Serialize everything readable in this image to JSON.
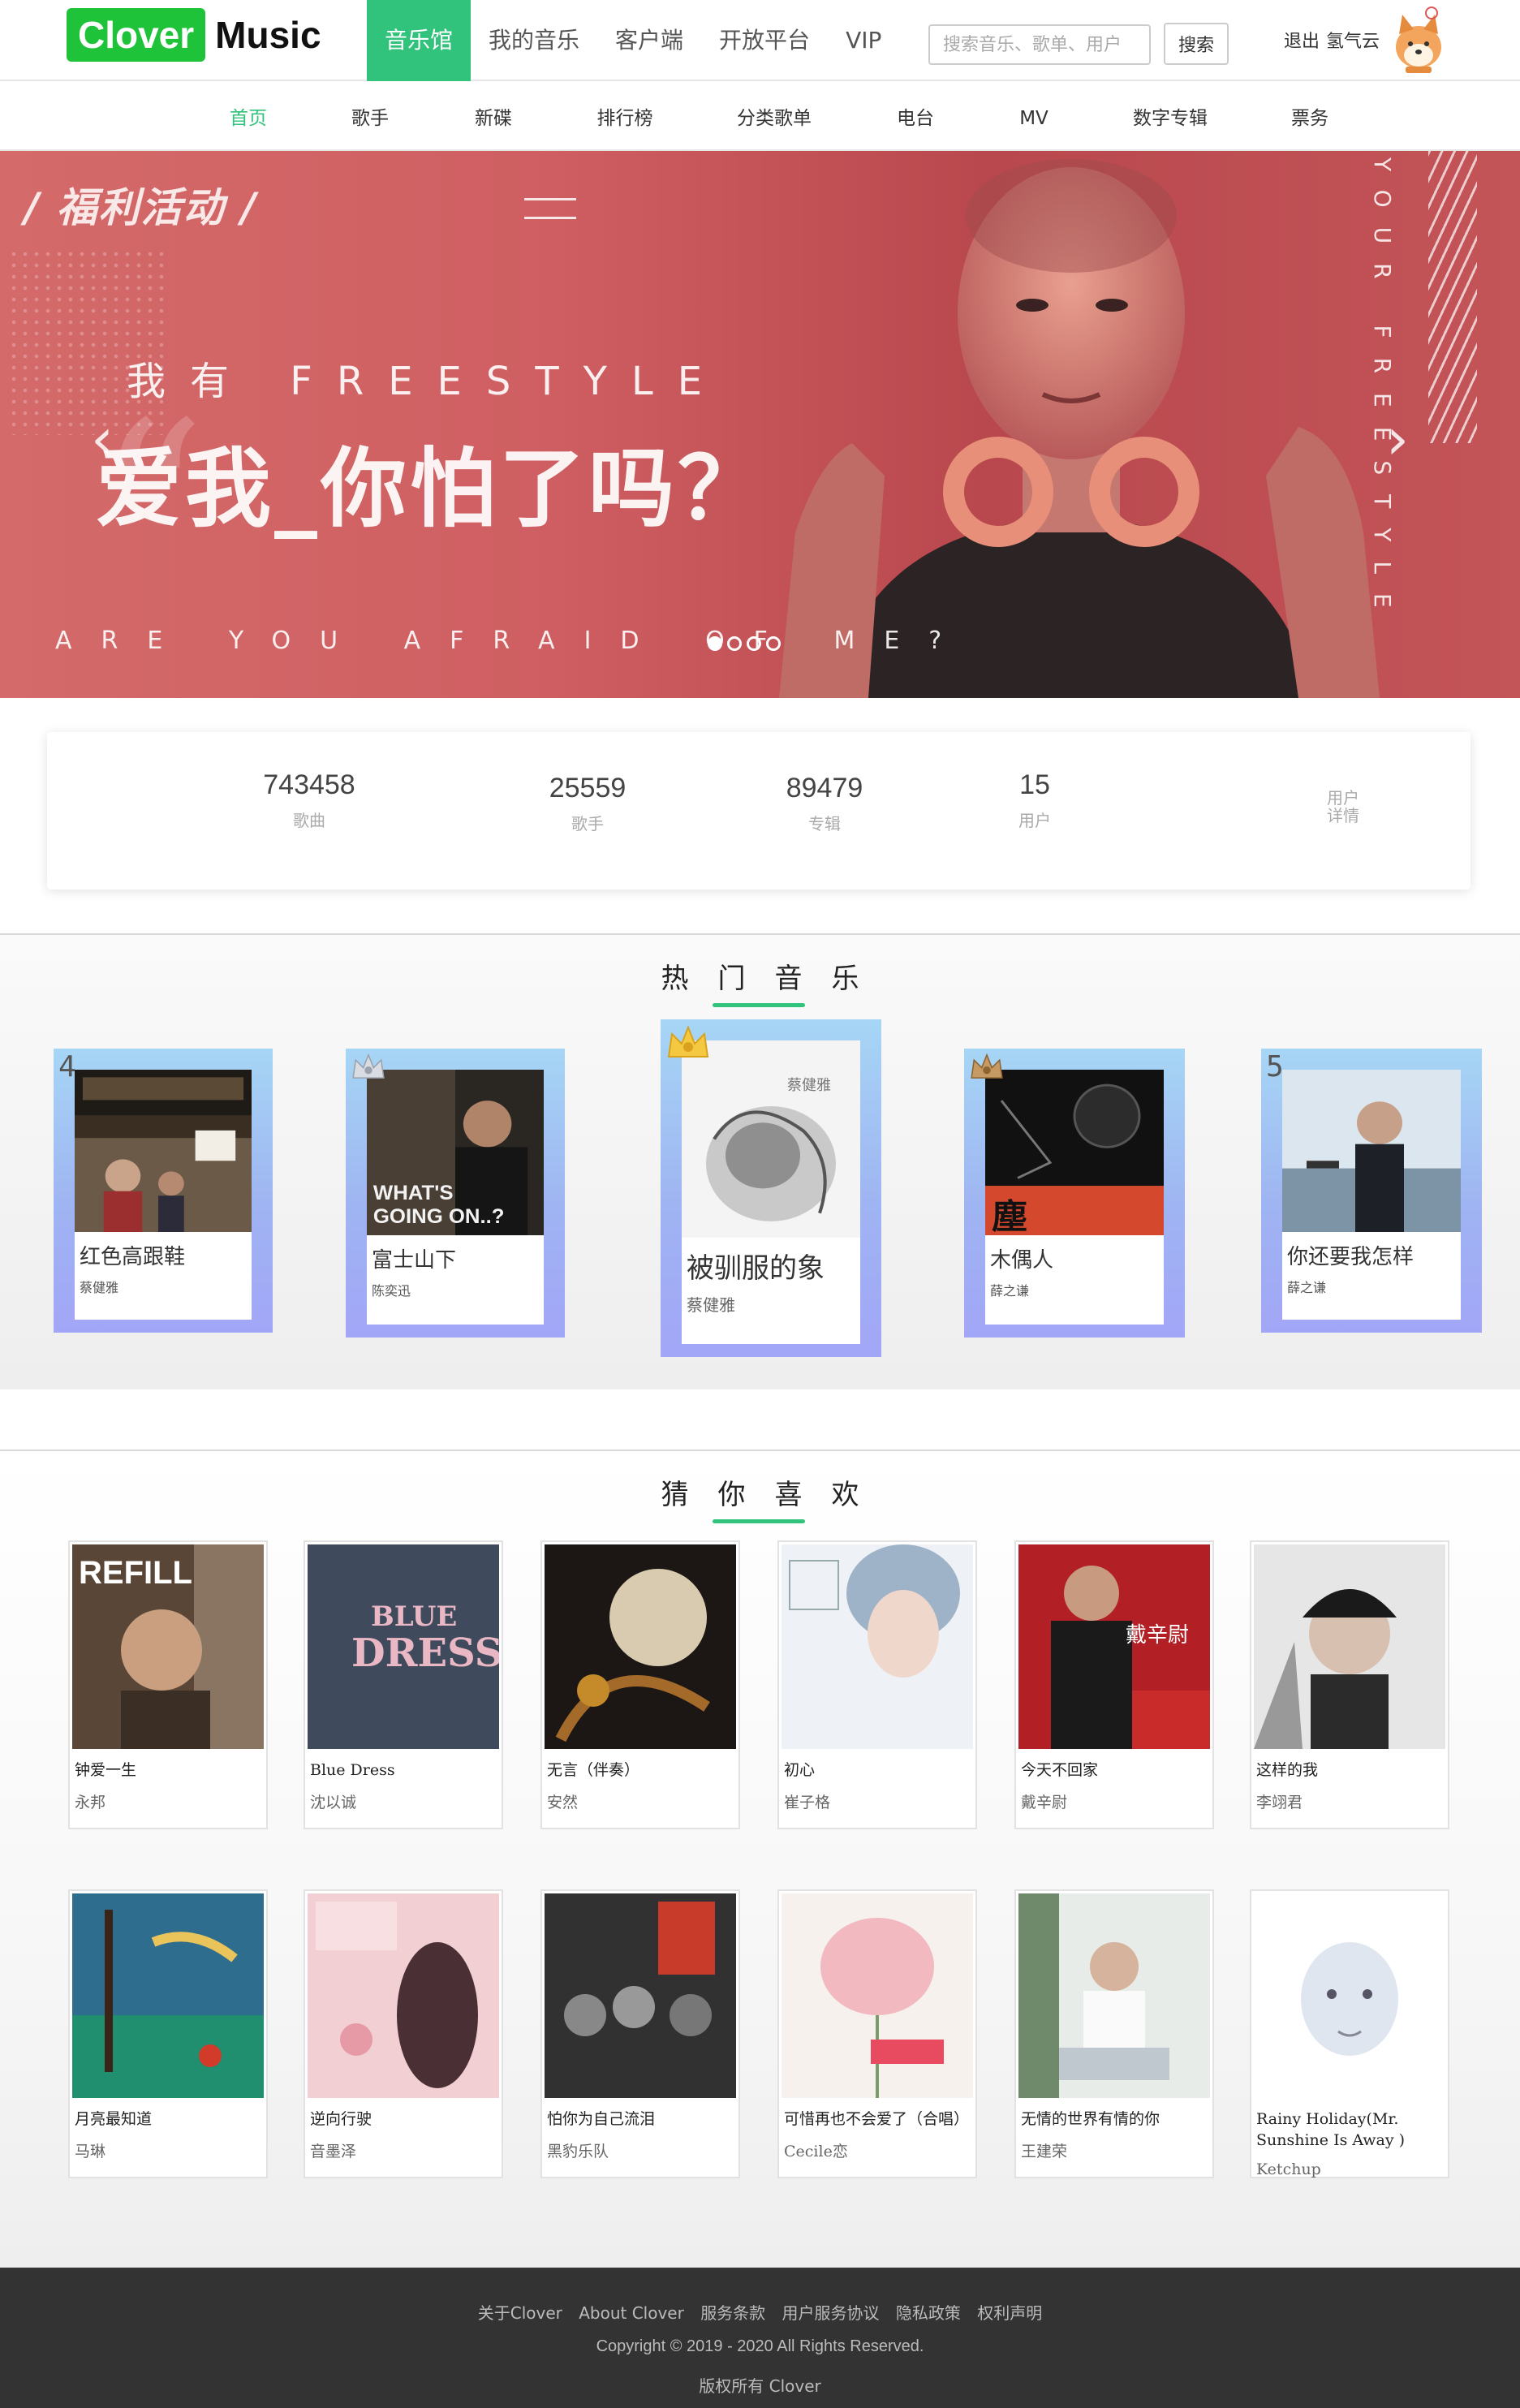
{
  "header": {
    "logo_box": "Clover",
    "logo_text": "Music",
    "nav": [
      "音乐馆",
      "我的音乐",
      "客户端",
      "开放平台",
      "VIP"
    ],
    "search_placeholder": "搜索音乐、歌单、用户",
    "search_button": "搜索",
    "logout": "退出",
    "username": "氢气云"
  },
  "subnav": [
    "首页",
    "歌手",
    "新碟",
    "排行榜",
    "分类歌单",
    "电台",
    "MV",
    "数字专辑",
    "票务"
  ],
  "banner": {
    "tag": "/ 福利活动 /",
    "line1": "我有 FREESTYLE",
    "line2": "爱我_你怕了吗？",
    "line3": "ARE YOU AFRAID OF ME?",
    "vertical": "YOUR FREESTYLE",
    "arrow_left": "‹",
    "arrow_right": "›"
  },
  "stats": {
    "items": [
      {
        "num": "743458",
        "label": "歌曲"
      },
      {
        "num": "25559",
        "label": "歌手"
      },
      {
        "num": "89479",
        "label": "专辑"
      },
      {
        "num": "15",
        "label": "用户"
      }
    ],
    "link": "用户详情"
  },
  "hot": {
    "title": "热门音乐",
    "items": [
      {
        "rank": "4",
        "song": "红色高跟鞋",
        "artist": "蔡健雅"
      },
      {
        "rank": "2",
        "song": "富士山下",
        "artist": "陈奕迅"
      },
      {
        "rank": "1",
        "song": "被驯服的象",
        "artist": "蔡健雅"
      },
      {
        "rank": "3",
        "song": "木偶人",
        "artist": "薛之谦"
      },
      {
        "rank": "5",
        "song": "你还要我怎样",
        "artist": "薛之谦"
      }
    ]
  },
  "guess": {
    "title": "猜你喜欢",
    "items": [
      {
        "song": "钟爱一生",
        "artist": "永邦"
      },
      {
        "song": "Blue Dress",
        "artist": "沈以诚"
      },
      {
        "song": "无言（伴奏）",
        "artist": "安然"
      },
      {
        "song": "初心",
        "artist": "崔子格"
      },
      {
        "song": "今天不回家",
        "artist": "戴辛尉"
      },
      {
        "song": "这样的我",
        "artist": "李翊君"
      },
      {
        "song": "月亮最知道",
        "artist": "马琳"
      },
      {
        "song": "逆向行驶",
        "artist": "音墨泽"
      },
      {
        "song": "怕你为自己流泪",
        "artist": "黑豹乐队"
      },
      {
        "song": "可惜再也不会爱了（合唱）",
        "artist": "Cecile恋"
      },
      {
        "song": "无情的世界有情的你",
        "artist": "王建荣"
      },
      {
        "song": "Rainy Holiday(Mr. Sunshine Is Away )",
        "artist": "Ketchup"
      }
    ]
  },
  "footer": {
    "links": [
      "关于Clover",
      "About Clover",
      "服务条款",
      "用户服务协议",
      "隐私政策",
      "权利声明"
    ],
    "copyright": "Copyright © 2019 - 2020 All Rights Reserved.",
    "rights": "版权所有 Clover"
  },
  "colors": {
    "accent": "#31c27c",
    "logo": "#1fc33a",
    "banner": "#c85459",
    "card_gradient_top": "#a6d6f5",
    "card_gradient_bottom": "#a2a6f7",
    "footer": "#333333"
  },
  "icons": [
    "shiba-avatar-icon",
    "crown-icon",
    "menu-lines-icon",
    "chevron-left-icon",
    "chevron-right-icon"
  ]
}
